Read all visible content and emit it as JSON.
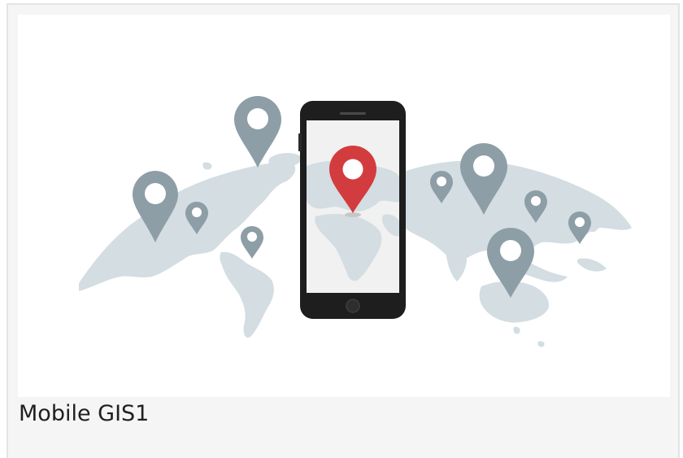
{
  "card": {
    "caption": "Mobile GIS1"
  },
  "illustration": {
    "map_icon": "world-map-icon",
    "phone_icon": "smartphone-icon",
    "pin_icon": "map-pin-icon",
    "colors": {
      "map": "#cfd9de",
      "pin_gray": "#8d9ea7",
      "pin_red": "#d33c3e",
      "phone_body": "#1f1f1f",
      "phone_screen": "#f2f2f2"
    }
  }
}
